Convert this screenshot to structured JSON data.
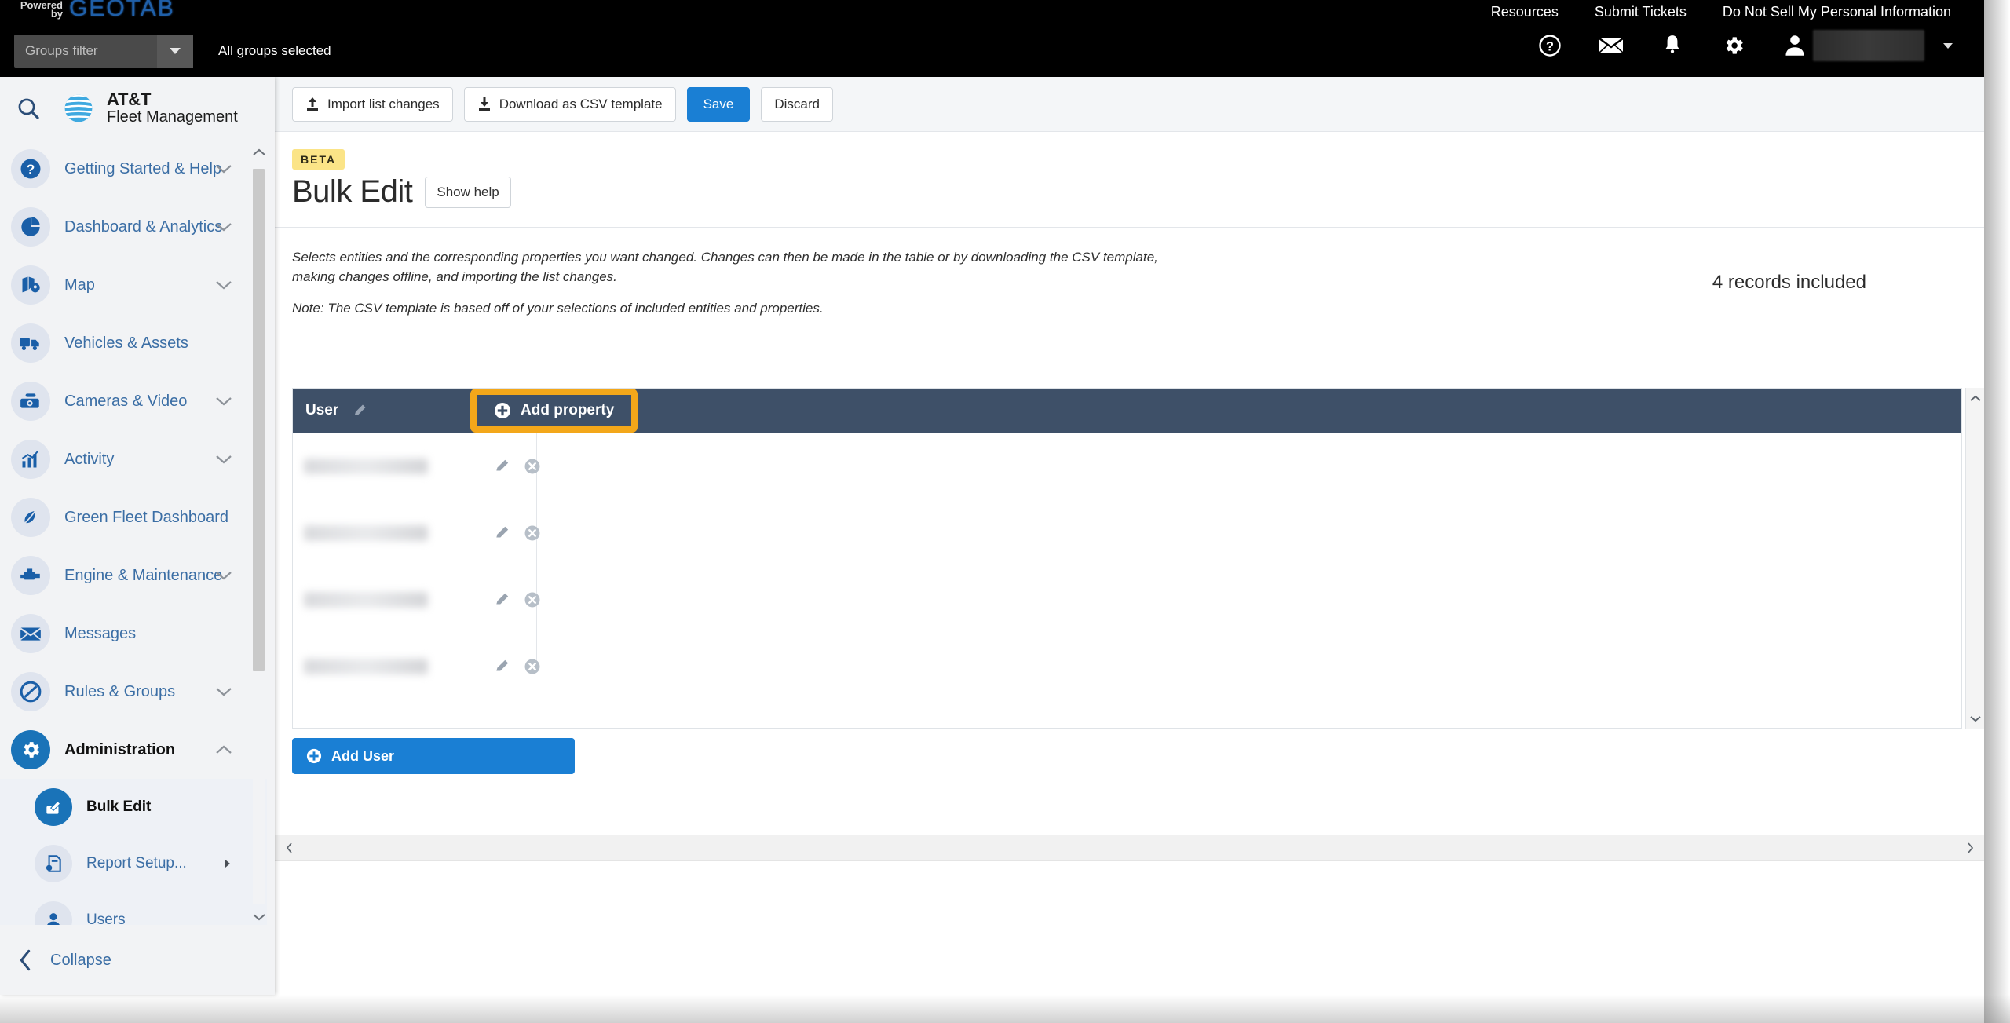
{
  "topbar": {
    "powered_by_line1": "Powered",
    "powered_by_line2": "by",
    "brand_logo_text": "GEOTAB",
    "links": [
      "Resources",
      "Submit Tickets",
      "Do Not Sell My Personal Information"
    ],
    "groups_filter_placeholder": "Groups filter",
    "groups_selected_text": "All groups selected",
    "icons": [
      "help-icon",
      "mail-icon",
      "bell-icon",
      "gear-icon",
      "user-avatar-icon"
    ]
  },
  "sidebar": {
    "brand_line1": "AT&T",
    "brand_line2": "Fleet Management",
    "search_icon": "search-icon",
    "items": [
      {
        "label": "Getting Started & Help",
        "icon": "help-circle-icon",
        "expandable": true
      },
      {
        "label": "Dashboard & Analytics",
        "icon": "pie-chart-icon",
        "expandable": true
      },
      {
        "label": "Map",
        "icon": "map-pin-icon",
        "expandable": true
      },
      {
        "label": "Vehicles & Assets",
        "icon": "truck-icon",
        "expandable": false
      },
      {
        "label": "Cameras & Video",
        "icon": "camera-icon",
        "expandable": true
      },
      {
        "label": "Activity",
        "icon": "bar-chart-icon",
        "expandable": true
      },
      {
        "label": "Green Fleet Dashboard",
        "icon": "leaf-icon",
        "expandable": false
      },
      {
        "label": "Engine & Maintenance",
        "icon": "engine-icon",
        "expandable": true
      },
      {
        "label": "Messages",
        "icon": "envelope-icon",
        "expandable": false
      },
      {
        "label": "Rules & Groups",
        "icon": "no-entry-icon",
        "expandable": true
      },
      {
        "label": "Administration",
        "icon": "gear-icon",
        "expandable": true,
        "expanded": true,
        "active_group": true
      }
    ],
    "sub_items": [
      {
        "label": "Bulk Edit",
        "icon": "bulk-edit-icon",
        "active": true
      },
      {
        "label": "Report Setup...",
        "icon": "report-setup-icon",
        "has_submenu": true
      },
      {
        "label": "Users",
        "icon": "user-icon"
      }
    ],
    "collapse_label": "Collapse"
  },
  "toolbar": {
    "import_label": "Import list changes",
    "download_label": "Download as CSV template",
    "save_label": "Save",
    "discard_label": "Discard"
  },
  "page": {
    "badge": "BETA",
    "title": "Bulk Edit",
    "show_help_label": "Show help",
    "description": "Selects entities and the corresponding properties you want changed. Changes can then be made in the table or by downloading the CSV template, making changes offline, and importing the list changes.",
    "note": "Note: The CSV template is based off of your selections of included entities and properties.",
    "records_included": "4 records included"
  },
  "table": {
    "column_header": "User",
    "column_header_edit_icon": "pencil-icon",
    "add_property_label": "Add property",
    "add_user_label": "Add User",
    "rows": [
      {
        "name": "",
        "redacted": true,
        "edit_icon": "pencil-icon",
        "remove_icon": "remove-circle-icon"
      },
      {
        "name": "",
        "redacted": true,
        "edit_icon": "pencil-icon",
        "remove_icon": "remove-circle-icon"
      },
      {
        "name": "",
        "redacted": true,
        "edit_icon": "pencil-icon",
        "remove_icon": "remove-circle-icon"
      },
      {
        "name": "",
        "redacted": true,
        "edit_icon": "pencil-icon",
        "remove_icon": "remove-circle-icon"
      }
    ]
  },
  "colors": {
    "accent_blue": "#1a7fd4",
    "sidebar_blue": "#3b6ea5",
    "table_header": "#3e5068",
    "highlight_orange": "#f3a71a",
    "beta_yellow": "#fbe487",
    "topbar_black": "#000000"
  }
}
